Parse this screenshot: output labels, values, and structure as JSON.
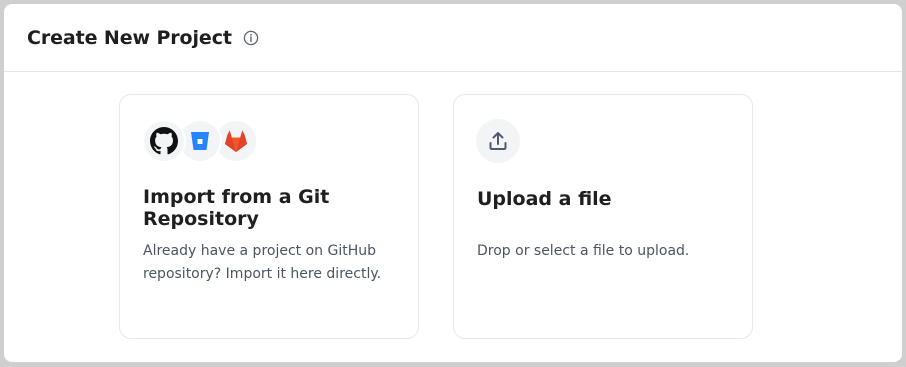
{
  "header": {
    "title": "Create New Project",
    "info_icon": "info-icon"
  },
  "cards": [
    {
      "id": "git",
      "title": "Import from a Git Repository",
      "description": "Already have a project on GitHub repository? Import it here directly.",
      "icons": [
        "github-icon",
        "bitbucket-icon",
        "gitlab-icon"
      ]
    },
    {
      "id": "upload",
      "title": "Upload a file",
      "description": "Drop or select a file to upload.",
      "icons": [
        "upload-icon"
      ]
    }
  ],
  "colors": {
    "github": "#111111",
    "bitbucket": "#2684FF",
    "gitlab": "#E24329",
    "upload": "#4b5b73"
  }
}
